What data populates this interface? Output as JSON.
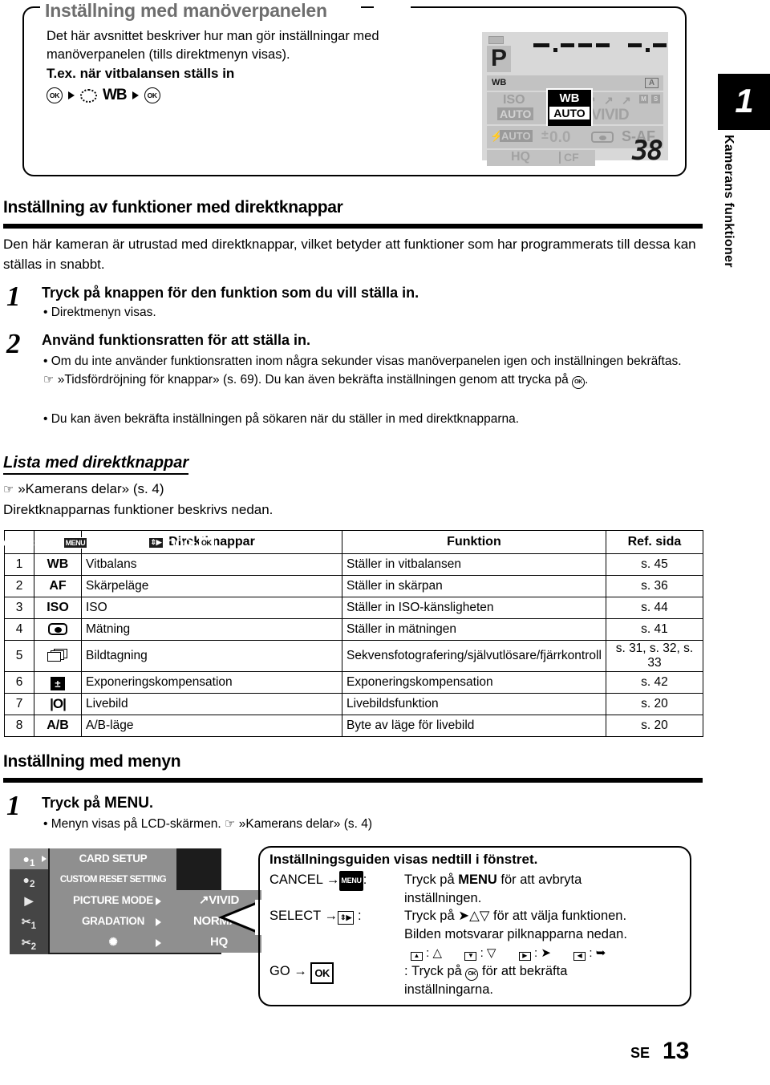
{
  "top_callout": {
    "title": "Inställning med manöverpanelen",
    "body": "Det här avsnittet beskriver hur man gör inställningar med manöverpanelen (tills direktmenyn visas).",
    "example_heading": "T.ex. när vitbalansen ställs in",
    "flow": [
      "OK",
      "dial",
      "WB",
      "OK"
    ]
  },
  "lcd_panel": {
    "shutter_dashes": "-.---",
    "aperture_dashes": "-.-",
    "mode": "P",
    "wb_label": "WB",
    "wb_auto_indicator": "A",
    "iso_label": "ISO",
    "iso_value": "AUTO",
    "picture_mode": "VIVID",
    "picture_mode_badges": [
      "M",
      "S"
    ],
    "flash_value": "AUTO",
    "exposure_comp": "0.0",
    "af_mode": "S-AF",
    "quality": "HQ",
    "card": "CF",
    "frames_remaining": "38",
    "highlight": {
      "label": "WB",
      "value": "AUTO"
    }
  },
  "chapter_tab": {
    "number": "1",
    "label": "Kamerans funktioner"
  },
  "section_direct": {
    "heading": "Inställning av funktioner med direktknappar",
    "intro": "Den här kameran är utrustad med direktknappar, vilket betyder att funktioner som har programmerats till dessa kan ställas in snabbt.",
    "step1_num": "1",
    "step1_title": "Tryck på knappen för den funktion som du vill ställa in.",
    "step1_bullet": "Direktmenyn visas.",
    "step2_num": "2",
    "step2_title": "Använd funktionsratten för att ställa in.",
    "step2_bullet1_a": "Om du inte använder funktionsratten inom några sekunder visas manöverpanelen igen och inställningen bekräftas.",
    "step2_bullet1_b": "»Tidsfördröjning för knappar» (s. 69). Du kan även bekräfta inställningen genom att trycka på",
    "step2_bullet1_c": ".",
    "step2_bullet2": "Du kan även bekräfta inställningen på sökaren när du ställer in med direktknapparna."
  },
  "section_list": {
    "heading": "Lista med direktknappar",
    "reference": "»Kamerans delar» (s. 4)",
    "subtitle": "Direktknapparnas funktioner beskrivs nedan."
  },
  "table": {
    "headers": [
      "",
      "",
      "Direktknappar",
      "Funktion",
      "Ref. sida"
    ],
    "rows": [
      {
        "no": "1",
        "icon": "WB",
        "icon_kind": "text",
        "name": "Vitbalans",
        "function": "Ställer in vitbalansen",
        "ref": "s. 45"
      },
      {
        "no": "2",
        "icon": "AF",
        "icon_kind": "text",
        "name": "Skärpeläge",
        "function": "Ställer in skärpan",
        "ref": "s. 36"
      },
      {
        "no": "3",
        "icon": "ISO",
        "icon_kind": "text",
        "name": "ISO",
        "function": "Ställer in ISO-känsligheten",
        "ref": "s. 44"
      },
      {
        "no": "4",
        "icon": "metering-icon",
        "icon_kind": "meter",
        "name": "Mätning",
        "function": "Ställer in mätningen",
        "ref": "s. 41"
      },
      {
        "no": "5",
        "icon": "drive-icon",
        "icon_kind": "drive",
        "name": "Bildtagning",
        "function": "Sekvensfotografering/självutlösare/fjärrkontroll",
        "ref": "s. 31, s. 32, s. 33"
      },
      {
        "no": "6",
        "icon": "exposure-comp-icon",
        "icon_kind": "expo",
        "name": "Exponeringskompensation",
        "function": "Exponeringskompensation",
        "ref": "s. 42"
      },
      {
        "no": "7",
        "icon": "|O|",
        "icon_kind": "live",
        "name": "Livebild",
        "function": "Livebildsfunktion",
        "ref": "s. 20"
      },
      {
        "no": "8",
        "icon": "A/B",
        "icon_kind": "text",
        "name": "A/B-läge",
        "function": "Byte av läge för livebild",
        "ref": "s. 20"
      }
    ]
  },
  "section_menu": {
    "heading": "Inställning med menyn",
    "step1_num": "1",
    "step1_title_a": "Tryck på ",
    "step1_title_b": "MENU",
    "step1_title_c": ".",
    "step1_bullet_a": "Menyn visas på LCD-skärmen.",
    "step1_bullet_b": "»Kamerans delar» (s. 4)"
  },
  "camera_menu": {
    "rail": [
      "1",
      "2",
      "play",
      "1",
      "2"
    ],
    "items": [
      {
        "label": "CARD SETUP",
        "value": "",
        "has_arrow": false
      },
      {
        "label": "CUSTOM RESET SETTING",
        "value": "",
        "has_arrow": false
      },
      {
        "label": "PICTURE MODE",
        "value": "VIVID",
        "has_arrow": true
      },
      {
        "label": "GRADATION",
        "value": "NORMAL",
        "has_arrow": true
      },
      {
        "label": "",
        "value": "HQ",
        "has_arrow": true
      }
    ],
    "guide": {
      "cancel_label": "CANCEL",
      "cancel_key": "MENU",
      "select_label": "SELECT",
      "go_label": "GO",
      "go_key": "OK"
    }
  },
  "bubble": {
    "title": "Inställningsguiden visas nedtill i fönstret.",
    "cancel_key": "CANCEL",
    "cancel_icon": "MENU",
    "cancel_text_a": "Tryck på ",
    "cancel_text_b": "MENU",
    "cancel_text_c": " för att avbryta",
    "cancel_text_d": "inställningen.",
    "select_key": "SELECT",
    "select_text_a": "Tryck på ",
    "select_text_b": " för att välja funktionen.",
    "select_text_c": "Bilden motsvarar pilknapparna nedan.",
    "go_key": "GO",
    "go_icon": "OK",
    "go_text_a": "Tryck på ",
    "go_text_b": " för att bekräfta",
    "go_text_c": "inställningarna."
  },
  "footer": {
    "locale": "SE",
    "page": "13"
  },
  "colors": {
    "title_gray": "#6e6e6e",
    "rule_black": "#000000",
    "lcd_bg": "#d8d8d8",
    "menu_bg": "#1c1c1c"
  }
}
